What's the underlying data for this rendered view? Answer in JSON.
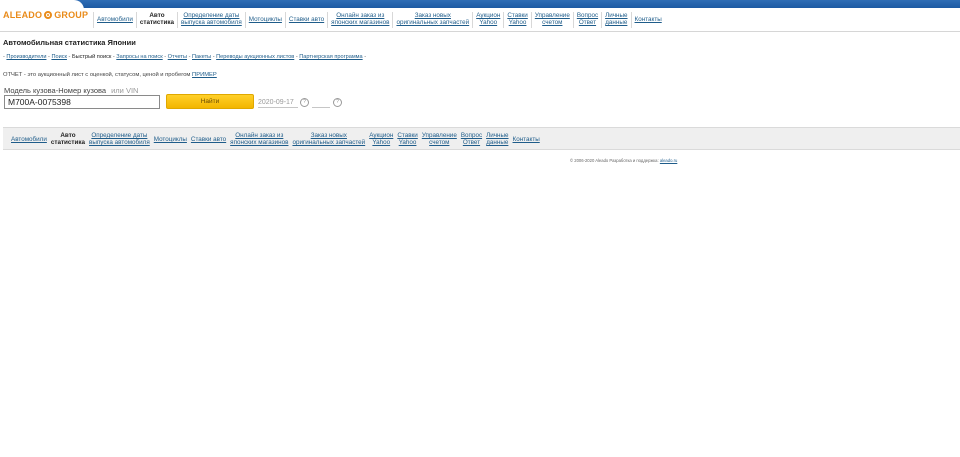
{
  "header": {
    "logo_left": "ALEADO",
    "logo_right": "GROUP",
    "colors": {
      "brand_blue": "#2f6db5",
      "logo_orange": "#e98b1a",
      "link": "#1e5c8a",
      "button_yellow": "#f3b600"
    }
  },
  "nav": [
    {
      "line1": "Автомобили",
      "line2": "",
      "active": false
    },
    {
      "line1": "Авто",
      "line2": "статистика",
      "active": true
    },
    {
      "line1": "Определение даты",
      "line2": "выпуска автомобиля",
      "active": false
    },
    {
      "line1": "Мотоциклы",
      "line2": "",
      "active": false
    },
    {
      "line1": "Ставки авто",
      "line2": "",
      "active": false
    },
    {
      "line1": "Онлайн заказ из",
      "line2": "японских магазинов",
      "active": false
    },
    {
      "line1": "Заказ новых",
      "line2": "оригинальных запчастей",
      "active": false
    },
    {
      "line1": "Аукцион",
      "line2": "Yahoo",
      "active": false
    },
    {
      "line1": "Ставки",
      "line2": "Yahoo",
      "active": false
    },
    {
      "line1": "Управление",
      "line2": "счетом",
      "active": false
    },
    {
      "line1": "Вопрос",
      "line2": "Ответ",
      "active": false
    },
    {
      "line1": "Личные",
      "line2": "данные",
      "active": false
    },
    {
      "line1": "Контакты",
      "line2": "",
      "active": false
    }
  ],
  "page": {
    "title": "Автомобильная статистика Японии",
    "breadcrumb": [
      {
        "label": "Производители",
        "current": false
      },
      {
        "label": "Поиск",
        "current": false
      },
      {
        "label": "Быстрый поиск",
        "current": true
      },
      {
        "label": "Запросы на поиск",
        "current": false
      },
      {
        "label": "Отчеты",
        "current": false
      },
      {
        "label": "Пакеты",
        "current": false
      },
      {
        "label": "Переводы аукционных листов",
        "current": false
      },
      {
        "label": "Партнерская программа",
        "current": false
      }
    ],
    "report_note_text": "ОТЧЕТ - это аукционный лист с оценкой, статусом, ценой и пробегом",
    "report_note_link": "ПРИМЕР",
    "search_label": "Модель кузова-Номер кузова",
    "search_label_alt": "или VIN",
    "search_value": "M700A-0075398",
    "search_button": "Найти",
    "date_value": "2020-09-17",
    "help_glyph": "?"
  },
  "footer": {
    "copyright_text": "© 2006-2020 Aleado Разработка и поддержка:",
    "copyright_link": "aleado.ru"
  }
}
